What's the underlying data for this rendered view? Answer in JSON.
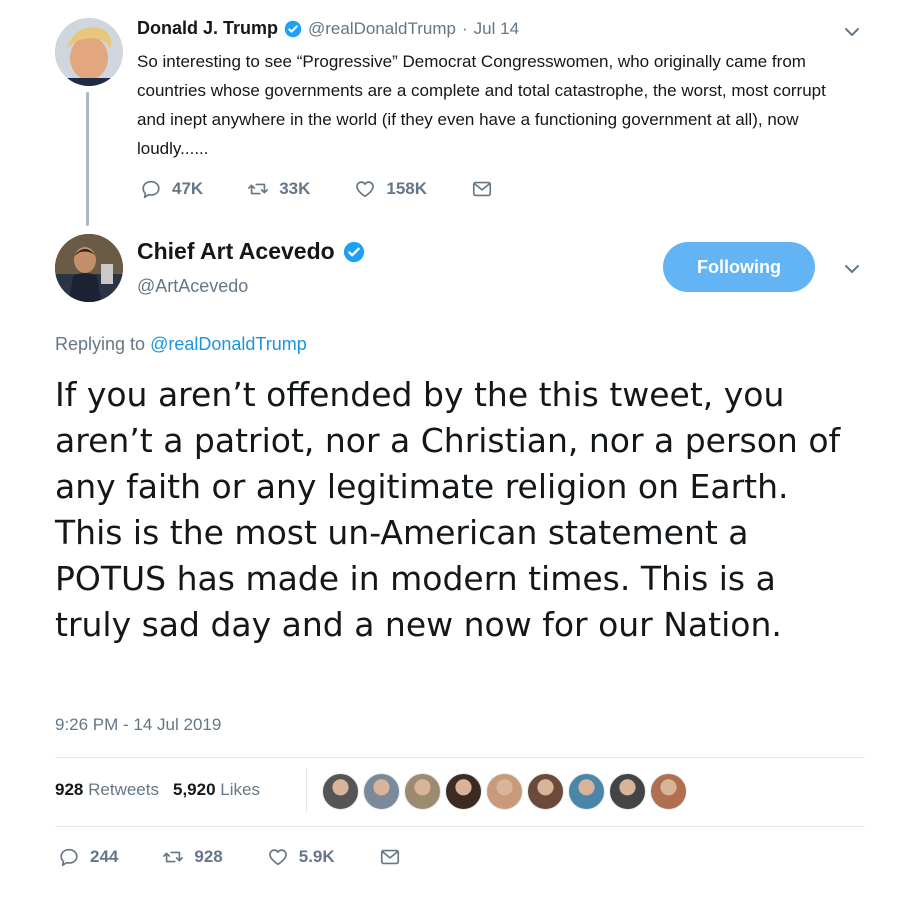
{
  "quoted": {
    "display_name": "Donald J. Trump",
    "handle": "@realDonaldTrump",
    "separator": "·",
    "date": "Jul 14",
    "text": "So interesting to see “Progressive” Democrat Congresswomen, who originally came from countries whose governments are a complete and total catastrophe, the worst, most corrupt and inept anywhere in the world (if they even have a functioning government at all), now loudly......",
    "actions": {
      "replies": "47K",
      "retweets": "33K",
      "likes": "158K"
    }
  },
  "tweet": {
    "display_name": "Chief Art Acevedo",
    "handle": "@ArtAcevedo",
    "follow_label": "Following",
    "replying_prefix": "Replying to",
    "replying_handle": "@realDonaldTrump",
    "text": "If you aren’t offended by the this tweet, you aren’t a patriot, nor a Christian, nor a person of any faith or any legitimate religion on Earth. This is the most un-American statement a POTUS has made in modern times. This is a truly sad day and a new now for our Nation.",
    "timestamp": "9:26 PM - 14 Jul 2019",
    "stats": {
      "retweets_count": "928",
      "retweets_label": "Retweets",
      "likes_count": "5,920",
      "likes_label": "Likes"
    },
    "liker_colors": [
      "#555555",
      "#7a8a99",
      "#9c8b6e",
      "#3d2b22",
      "#c99a7a",
      "#6b4a3a",
      "#4a86a8",
      "#444444",
      "#b07050"
    ],
    "actions": {
      "replies": "244",
      "retweets": "928",
      "likes": "5.9K"
    }
  },
  "colors": {
    "accent": "#1b95e0",
    "verified": "#1da1f2",
    "follow_button": "#63b4f4"
  },
  "icons": [
    "verified-badge-icon",
    "chevron-down-icon",
    "reply-icon",
    "retweet-icon",
    "like-icon",
    "direct-message-icon"
  ]
}
